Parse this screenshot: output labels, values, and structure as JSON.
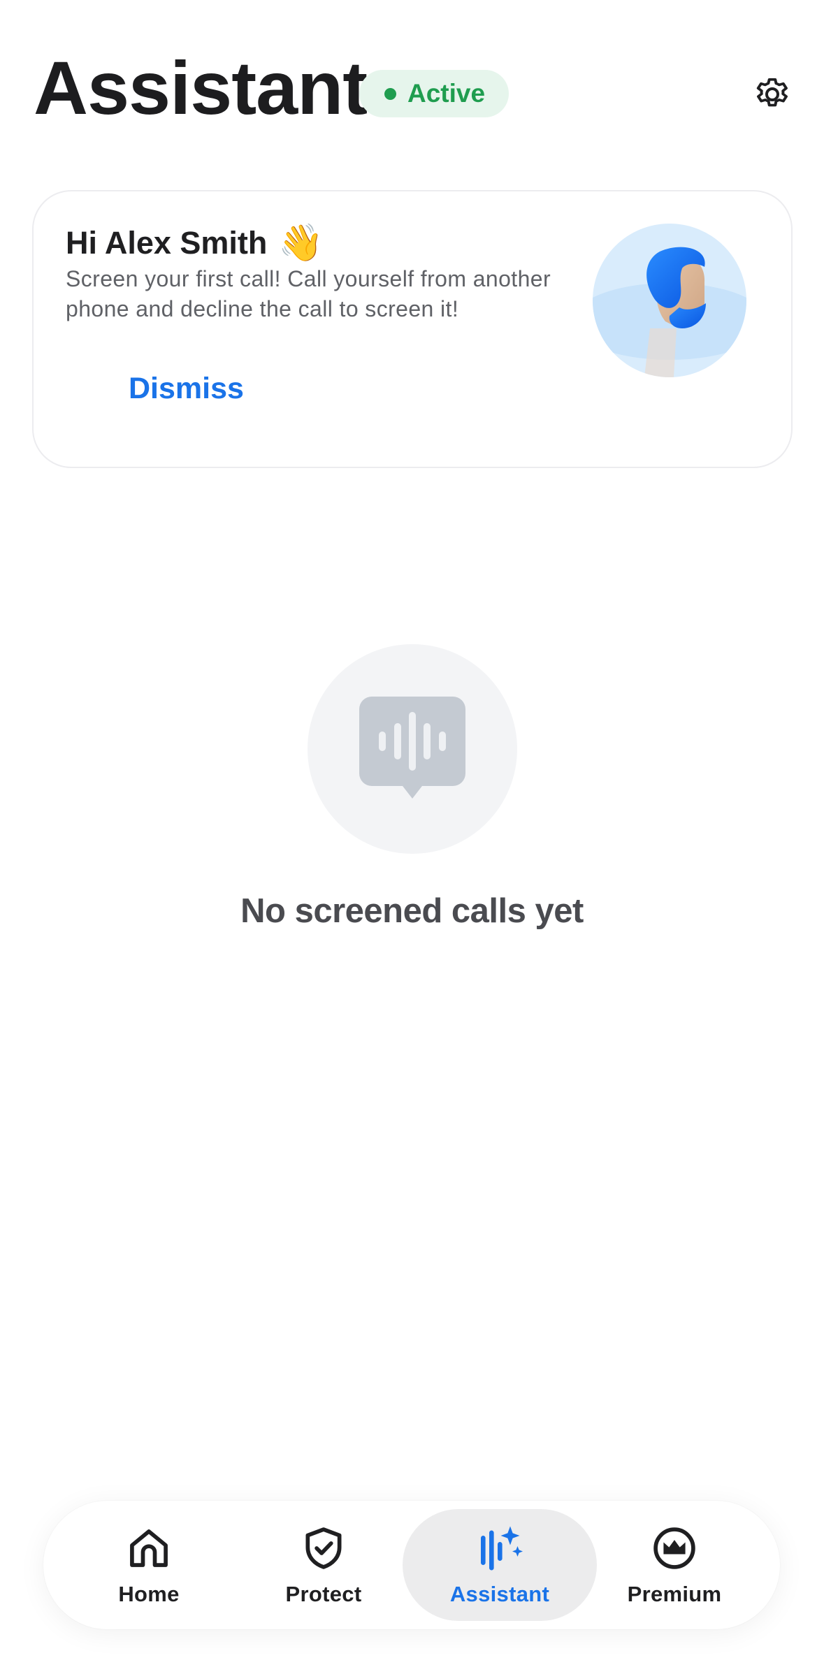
{
  "header": {
    "title": "Assistant",
    "status": "Active"
  },
  "welcome_card": {
    "greeting": "Hi Alex Smith",
    "emoji": "👋",
    "message": "Screen your first call! Call yourself from another phone and decline the call to screen it!",
    "dismiss_label": "Dismiss"
  },
  "empty_state": {
    "text": "No screened calls yet",
    "icon": "voice-message-icon"
  },
  "bottom_nav": {
    "items": [
      {
        "label": "Home",
        "icon": "home-icon"
      },
      {
        "label": "Protect",
        "icon": "shield-check-icon"
      },
      {
        "label": "Assistant",
        "icon": "assistant-waveform-icon",
        "active": true
      },
      {
        "label": "Premium",
        "icon": "crown-icon"
      }
    ]
  },
  "colors": {
    "accent": "#1a73e8",
    "status_green": "#1f9d4f",
    "status_bg": "#e6f5ec"
  }
}
